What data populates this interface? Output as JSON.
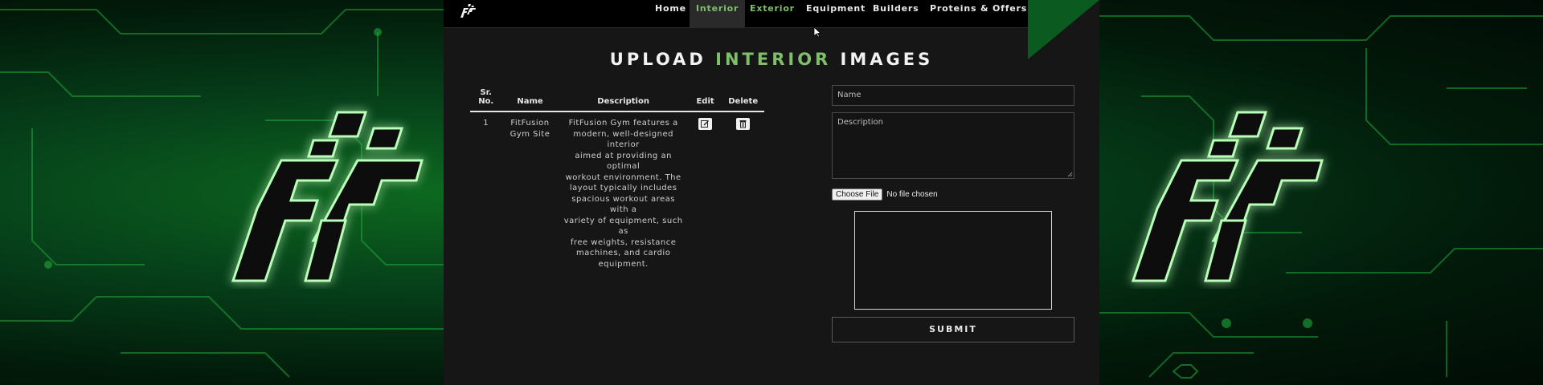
{
  "nav": {
    "items": [
      {
        "label": "Home",
        "state": "normal"
      },
      {
        "label": "Interior",
        "state": "active"
      },
      {
        "label": "Exterior",
        "state": "highlight"
      },
      {
        "label": "Equipment",
        "state": "normal"
      },
      {
        "label": "Builders",
        "state": "normal"
      },
      {
        "label": "Proteins & Offers",
        "state": "normal"
      }
    ]
  },
  "page": {
    "title_part1": "UPLOAD",
    "title_accent": "INTERIOR",
    "title_part2": "IMAGES"
  },
  "table": {
    "headers": {
      "sr_line1": "Sr.",
      "sr_line2": "No.",
      "name": "Name",
      "description": "Description",
      "edit": "Edit",
      "delete": "Delete"
    },
    "rows": [
      {
        "sr": "1",
        "name_line1": "FitFusion",
        "name_line2": "Gym Site",
        "description_lines": [
          "FitFusion Gym features a",
          "modern, well-designed interior",
          "aimed at providing an optimal",
          "workout environment. The",
          "layout typically includes",
          "spacious workout areas with a",
          "variety of equipment, such as",
          "free weights, resistance",
          "machines, and cardio",
          "equipment."
        ]
      }
    ]
  },
  "form": {
    "name_placeholder": "Name",
    "description_placeholder": "Description",
    "file_button": "Choose File",
    "file_status": "No file chosen",
    "submit_label": "SUBMIT"
  },
  "colors": {
    "accent": "#7fbf6a",
    "background_green": "#0d6a1f",
    "panel": "#161616"
  },
  "icons": {
    "brand": "fitfusion-logo",
    "edit": "edit-icon",
    "delete": "trash-icon",
    "cursor": "mouse-pointer-icon"
  }
}
